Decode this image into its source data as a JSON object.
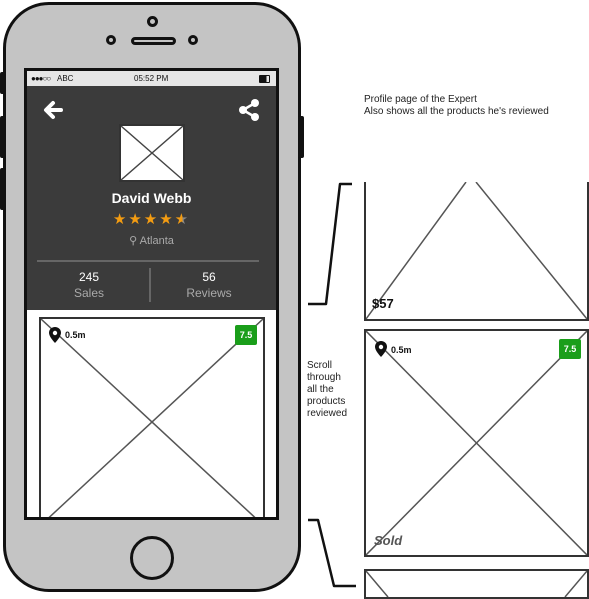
{
  "status_bar": {
    "carrier": "ABC",
    "time": "05:52 PM"
  },
  "profile": {
    "name": "David Webb",
    "rating": 4.5,
    "location": "Atlanta",
    "sales_count": "245",
    "sales_label": "Sales",
    "reviews_count": "56",
    "reviews_label": "Reviews"
  },
  "product_card": {
    "distance": "0.5m",
    "score": "7.5"
  },
  "annotations": {
    "profile_note_1": "Profile page of the Expert",
    "profile_note_2": "Also shows all the products he's reviewed",
    "scroll_note": [
      "Scroll",
      "through",
      "all the",
      "products",
      "reviewed"
    ]
  },
  "side_cards": [
    {
      "price": "$57"
    },
    {
      "distance": "0.5m",
      "score": "7.5",
      "status": "Sold"
    }
  ],
  "colors": {
    "header_bg": "#3b3b3b",
    "star": "#f39c12",
    "score_badge": "#1a9e1a"
  }
}
